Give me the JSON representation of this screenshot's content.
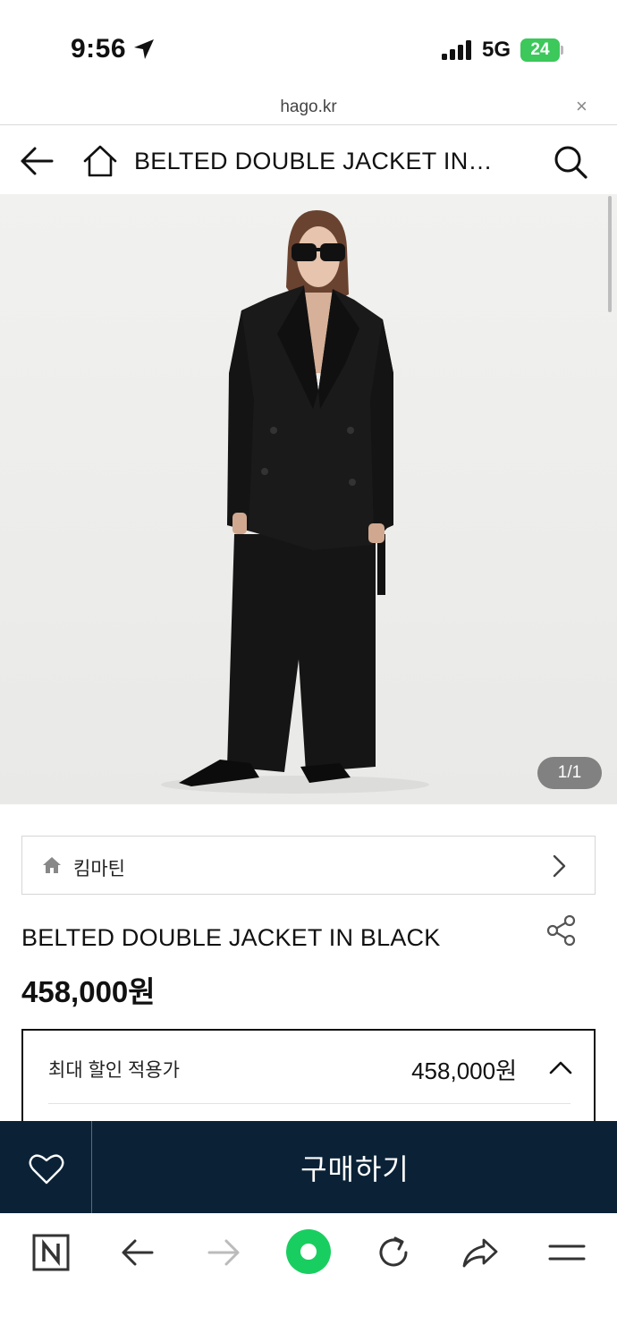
{
  "status_bar": {
    "time": "9:56",
    "network": "5G",
    "battery": "24"
  },
  "url_bar": {
    "domain": "hago.kr",
    "close_label": "×"
  },
  "header": {
    "title": "BELTED DOUBLE JACKET IN…"
  },
  "gallery": {
    "counter": "1/1"
  },
  "brand": {
    "name": "킴마틴"
  },
  "product": {
    "title": "BELTED DOUBLE JACKET IN BLACK",
    "price": "458,000원"
  },
  "discount": {
    "label": "최대 할인 적용가",
    "price": "458,000원"
  },
  "buy_bar": {
    "buy_label": "구매하기"
  },
  "colors": {
    "buy_bar_bg": "#0b2236",
    "battery_green": "#3cc85a",
    "naver_green": "#19ce60"
  },
  "icons": {
    "status": [
      "location-arrow-icon",
      "signal-icon",
      "battery-icon"
    ],
    "header": [
      "back-arrow-icon",
      "home-icon",
      "search-icon"
    ],
    "toolbar": [
      "naver-n-icon",
      "back-arrow-icon",
      "forward-arrow-icon",
      "green-dot-icon",
      "reload-icon",
      "share-icon",
      "menu-icon"
    ]
  }
}
